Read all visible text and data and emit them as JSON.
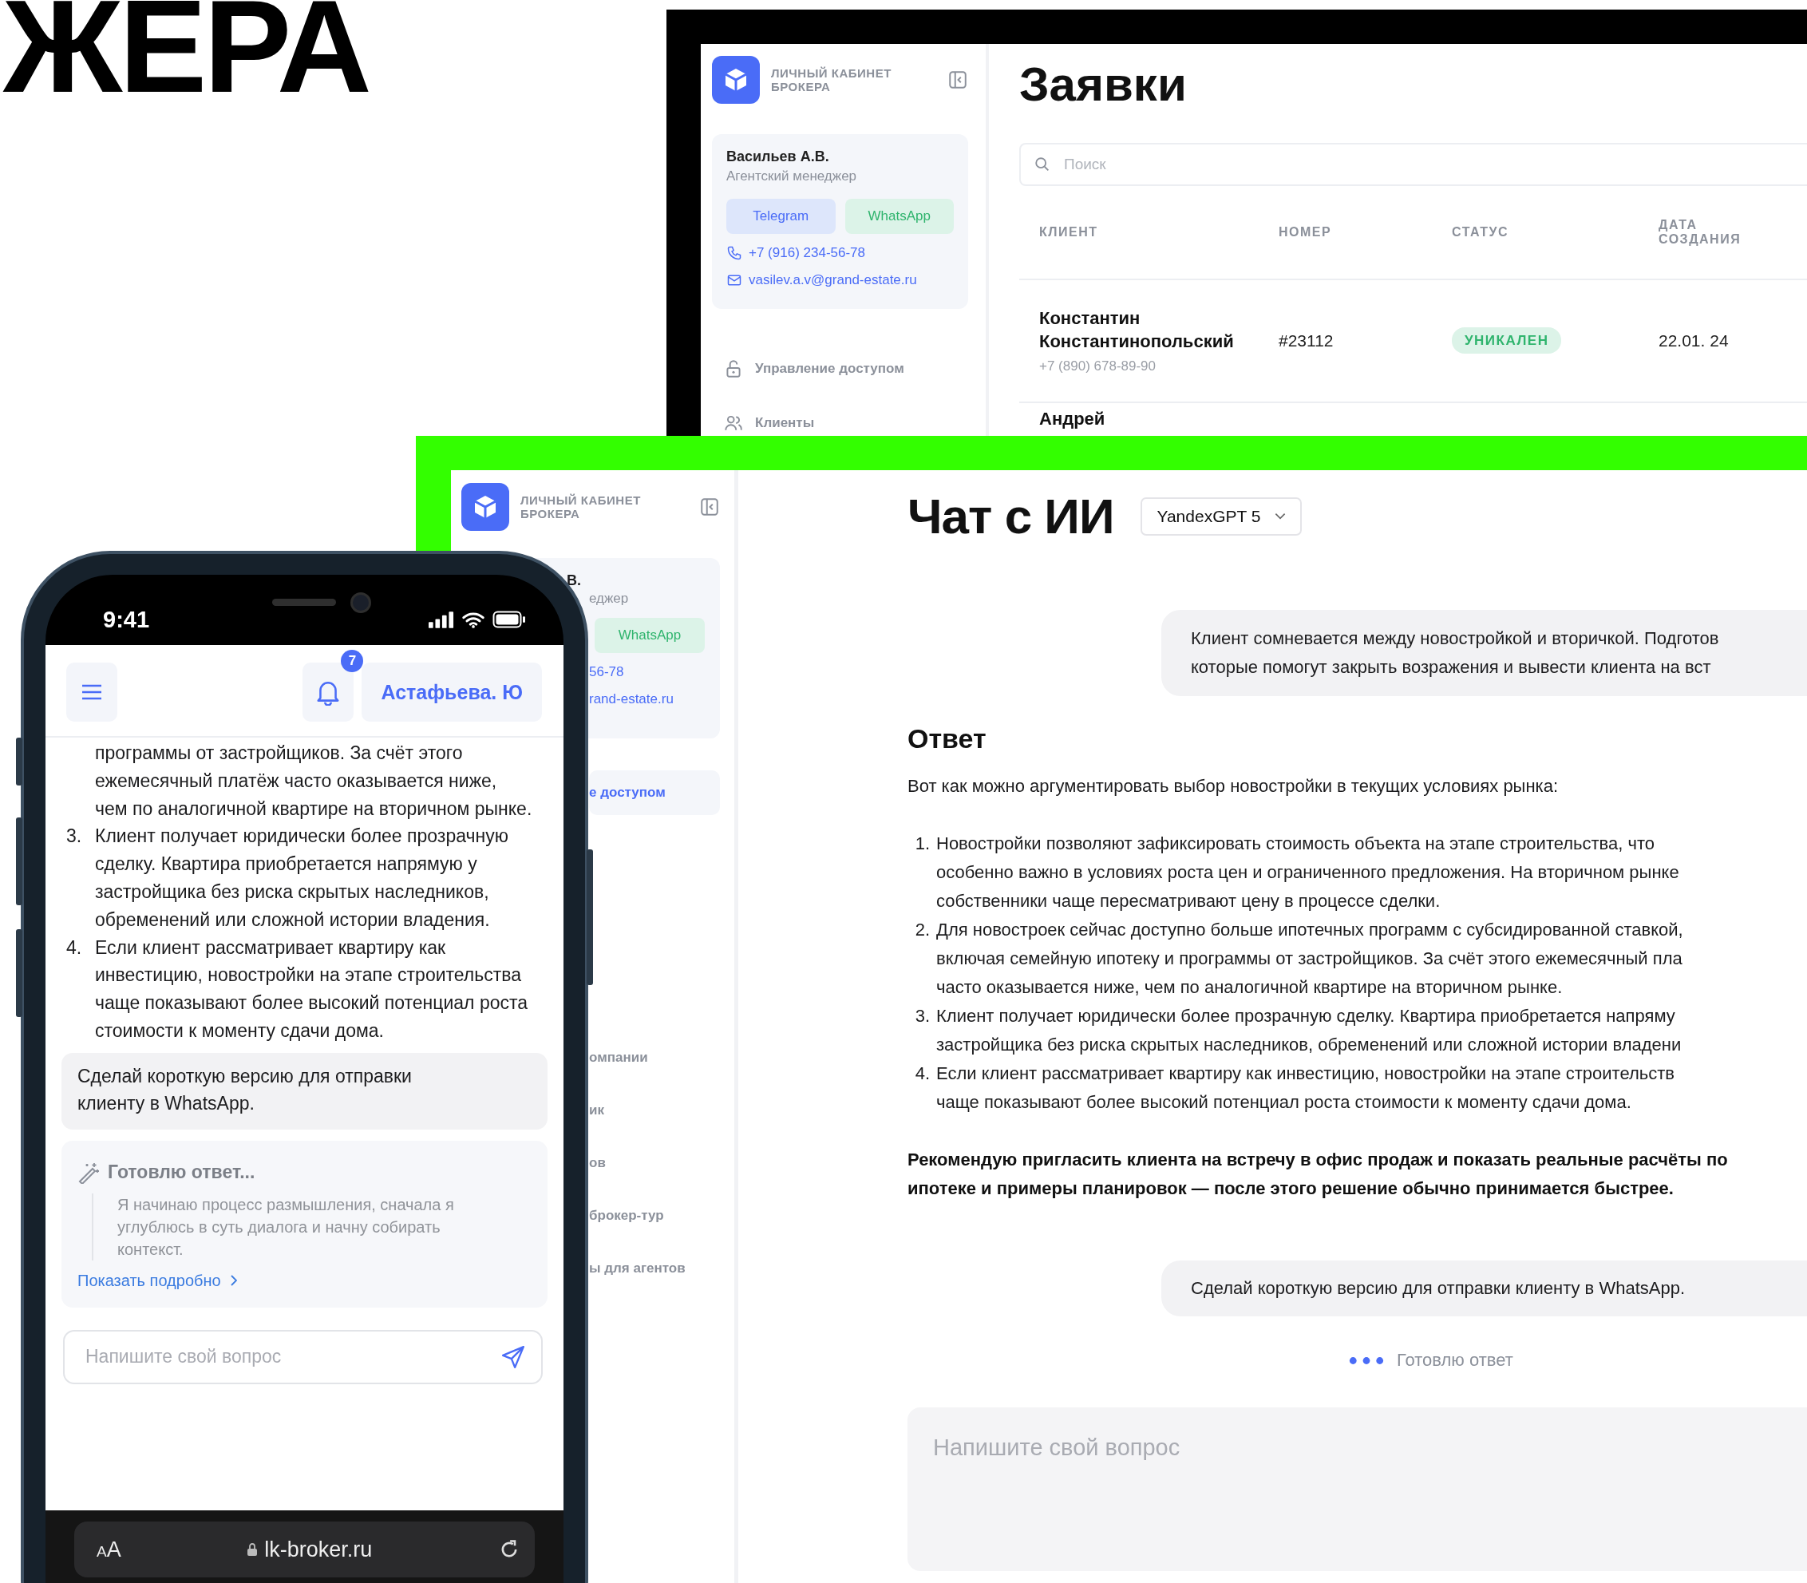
{
  "headline": "ЖЕРА",
  "requests_window": {
    "sidebar": {
      "brand": "ЛИЧНЫЙ КАБИНЕТ БРОКЕРА",
      "manager": {
        "name": "Васильев А.В.",
        "role": "Агентский менеджер",
        "buttons": [
          {
            "label": "Telegram",
            "kind": "telegram"
          },
          {
            "label": "WhatsApp",
            "kind": "whatsapp"
          }
        ],
        "phone": "+7 (916) 234-56-78",
        "email": "vasilev.a.v@grand-estate.ru"
      },
      "nav": [
        {
          "label": "Управление доступом",
          "kind": "access",
          "selected": false
        },
        {
          "label": "Клиенты",
          "kind": "clients",
          "selected": false
        }
      ]
    },
    "title": "Заявки",
    "search": {
      "placeholder": "Поиск"
    },
    "table": {
      "columns": [
        "КЛИЕНТ",
        "НОМЕР",
        "СТАТУС",
        "ДАТА СОЗДАНИЯ"
      ],
      "rows": [
        {
          "client": "Константин Константинопольский",
          "phone": "+7 (890) 678-89-90",
          "number": "#23112",
          "status": "УНИКАЛЕН",
          "date": "22.01. 24"
        },
        {
          "client": "Андрей"
        }
      ]
    }
  },
  "chat_window": {
    "sidebar": {
      "brand": "ЛИЧНЫЙ КАБИНЕТ БРОКЕРА",
      "manager": {
        "name": "В.",
        "role": "еджер",
        "button": {
          "label": "WhatsApp",
          "kind": "whatsapp"
        },
        "phone": "56-78",
        "email": "rand-estate.ru"
      },
      "nav": [
        {
          "label": "е доступом",
          "selected": true
        },
        {
          "label": "омпании",
          "selected": false
        },
        {
          "label": "ик",
          "selected": false
        },
        {
          "label": "ов",
          "selected": false
        },
        {
          "label": "брокер-тур",
          "selected": false
        },
        {
          "label": "ы для агентов",
          "selected": false
        }
      ]
    },
    "title": "Чат с ИИ",
    "model": "YandexGPT 5",
    "request": [
      "Клиент сомневается между новостройкой и вторичкой. Подготов",
      "которые помогут закрыть возражения и вывести клиента на вст"
    ],
    "answer": {
      "heading": "Ответ",
      "intro": "Вот как можно аргументировать выбор новостройки в текущих условиях рынка:",
      "items": [
        {
          "number": "1.",
          "lines": [
            "Новостройки позволяют зафиксировать стоимость объекта на этапе строительства, что",
            "особенно важно в условиях роста цен и ограниченного предложения. На вторичном рынке",
            "собственники чаще пересматривают цену в процессе сделки."
          ]
        },
        {
          "number": "2.",
          "lines": [
            "Для новостроек сейчас доступно больше ипотечных программ с субсидированной ставкой,",
            "включая семейную ипотеку и программы от застройщиков. За счёт этого ежемесячный пла",
            "часто оказывается ниже, чем по аналогичной квартире на вторичном рынке."
          ]
        },
        {
          "number": "3.",
          "lines": [
            "Клиент получает юридически более прозрачную сделку. Квартира приобретается напряму",
            "застройщика без риска скрытых наследников, обременений или сложной истории владени"
          ]
        },
        {
          "number": "4.",
          "lines": [
            "Если клиент рассматривает квартиру как инвестицию, новостройки на этапе строительств",
            "чаще показывают более высокий потенциал роста стоимости к моменту сдачи дома."
          ]
        }
      ],
      "closing": [
        "Рекомендую пригласить клиента на встречу в офис продаж и показать реальные расчёты по",
        "ипотеке и примеры планировок — после этого решение обычно принимается быстрее."
      ]
    },
    "request_2": "Сделай короткую версию для отправки клиенту в WhatsApp.",
    "status": "Готовлю ответ",
    "input": {
      "placeholder": "Напишите свой вопрос"
    }
  },
  "phone": {
    "time": "9:41",
    "notifications": "7",
    "user": "Астафьева. Ю",
    "items": [
      {
        "text": "программы от застройщиков. За счёт этого ежемесячный платёж часто оказывается ниже, чем по аналогичной квартире на вторичном рынке."
      },
      {
        "number": "3.",
        "text": "Клиент получает юридически более прозрачную сделку. Квартира приобретается напрямую у застройщика без риска скрытых наследников, обременений или сложной истории владения."
      },
      {
        "number": "4.",
        "text": "Если клиент рассматривает квартиру как инвестицию, новостройки на этапе строительства чаще показывают более высокий потенциал роста стоимости к моменту сдачи дома."
      }
    ],
    "request": "Сделай короткую версию для отправки клиенту в WhatsApp.",
    "thinking": {
      "title": "Готовлю ответ...",
      "text": "Я начинаю процесс размышления, сначала я углублюсь в суть диалога и начну собирать контекст.",
      "link": "Показать подробно"
    },
    "input": {
      "placeholder": "Напишите свой вопрос"
    },
    "browser": {
      "text_size": "AA",
      "url": "lk-broker.ru"
    }
  }
}
